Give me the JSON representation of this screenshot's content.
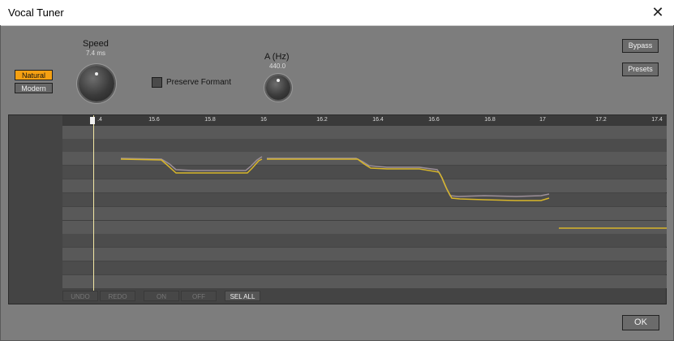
{
  "window": {
    "title": "Vocal Tuner",
    "close_glyph": "✕"
  },
  "controls": {
    "speed": {
      "label": "Speed",
      "value": "7.4 ms"
    },
    "a_hz": {
      "label": "A (Hz)",
      "value": "440.0"
    },
    "modes": {
      "natural": "Natural",
      "modern": "Modern",
      "selected": "Natural"
    },
    "preserve_formant": {
      "label": "Preserve Formant",
      "checked": false
    },
    "bypass_label": "Bypass",
    "presets_label": "Presets"
  },
  "timeline": {
    "ticks": [
      ".4",
      "15.6",
      "15.8",
      "16",
      "16.2",
      "16.4",
      "16.6",
      "16.8",
      "17",
      "17.2",
      "17.4"
    ]
  },
  "edit_buttons": {
    "undo": "UNDO",
    "redo": "REDO",
    "on": "ON",
    "off": "OFF",
    "sel_all": "SEL ALL"
  },
  "ok_label": "OK",
  "colors": {
    "background": "#7d7d7d",
    "accent": "#f5a012",
    "corrected_pitch": "#d8b62a",
    "detected_pitch": "#9c8f98",
    "playhead": "#f3e7a4"
  }
}
